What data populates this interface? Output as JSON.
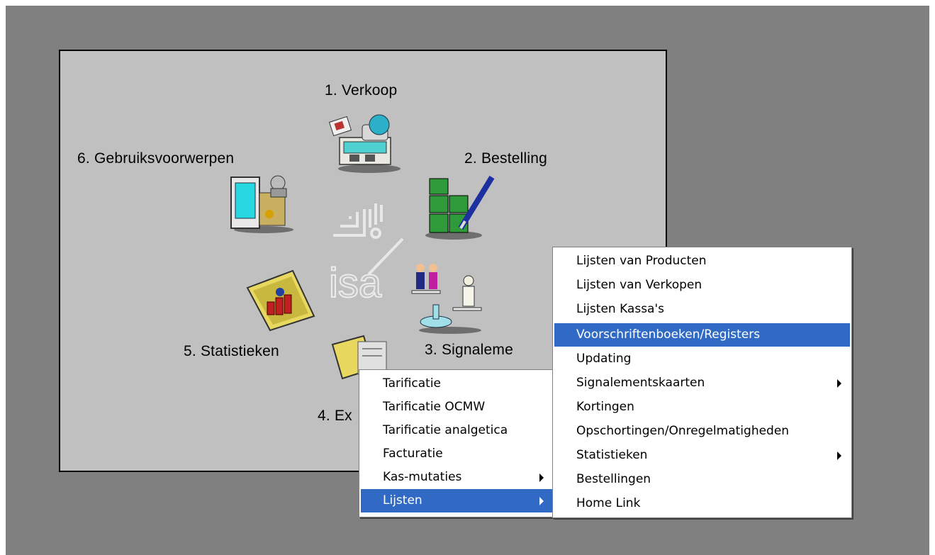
{
  "modules": {
    "verkoop": "1. Verkoop",
    "bestelling": "2. Bestelling",
    "signalement": "3. Signaleme",
    "extra": "4. Ex",
    "statistieken": "5. Statistieken",
    "gebruiksvoorwerpen": "6. Gebruiksvoorwerpen"
  },
  "logo": {
    "text": "isa"
  },
  "menu1": {
    "items": [
      {
        "label": "Tarificatie",
        "submenu": false,
        "selected": false
      },
      {
        "label": "Tarificatie OCMW",
        "submenu": false,
        "selected": false
      },
      {
        "label": "Tarificatie analgetica",
        "submenu": false,
        "selected": false
      },
      {
        "label": "Facturatie",
        "submenu": false,
        "selected": false
      },
      {
        "label": "Kas-mutaties",
        "submenu": true,
        "selected": false
      },
      {
        "label": "Lijsten",
        "submenu": true,
        "selected": true
      }
    ]
  },
  "menu2": {
    "items": [
      {
        "label": "Lijsten van Producten",
        "submenu": false,
        "selected": false
      },
      {
        "label": "Lijsten van Verkopen",
        "submenu": false,
        "selected": false
      },
      {
        "label": "Lijsten Kassa's",
        "submenu": false,
        "selected": false
      },
      {
        "label": "Voorschriftenboeken/Registers",
        "submenu": false,
        "selected": true
      },
      {
        "label": "Updating",
        "submenu": false,
        "selected": false
      },
      {
        "label": "Signalementskaarten",
        "submenu": true,
        "selected": false
      },
      {
        "label": "Kortingen",
        "submenu": false,
        "selected": false
      },
      {
        "label": "Opschortingen/Onregelmatigheden",
        "submenu": false,
        "selected": false
      },
      {
        "label": "Statistieken",
        "submenu": true,
        "selected": false
      },
      {
        "label": "Bestellingen",
        "submenu": false,
        "selected": false
      },
      {
        "label": "Home Link",
        "submenu": false,
        "selected": false
      }
    ]
  },
  "colors": {
    "selection": "#316ac5",
    "desktop": "#808080",
    "panel": "#c0c0c0"
  }
}
